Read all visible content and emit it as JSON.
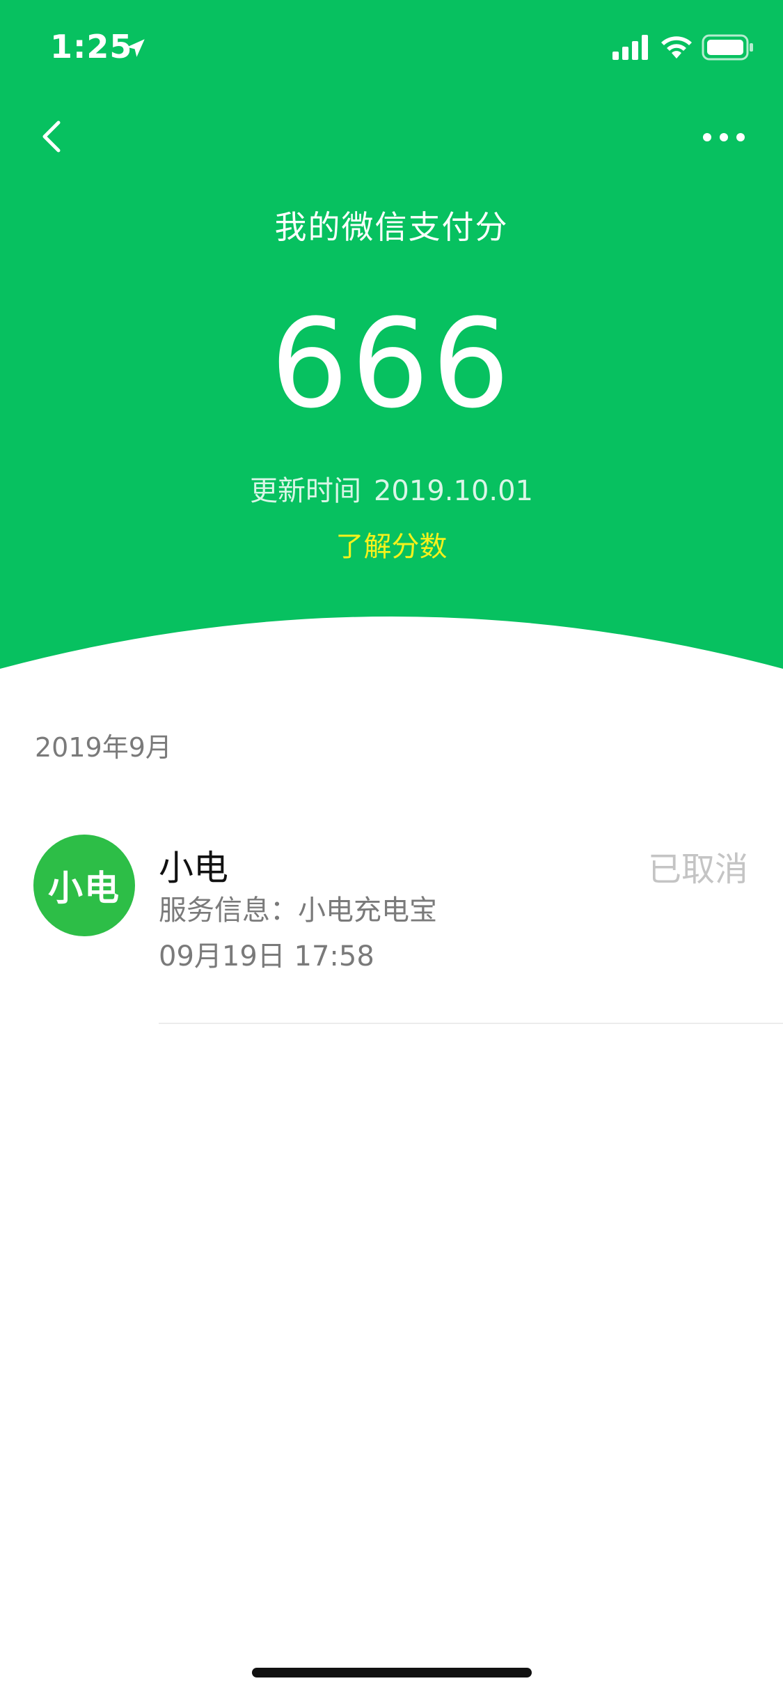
{
  "status_bar": {
    "time": "1:25",
    "location_icon": "location-arrow-icon",
    "signal_icon": "cellular-signal-icon",
    "wifi_icon": "wifi-icon",
    "battery_icon": "battery-icon"
  },
  "nav": {
    "back_icon": "chevron-left-icon",
    "more_icon": "more-dots-icon"
  },
  "header": {
    "title": "我的微信支付分",
    "score": "666",
    "update_label": "更新时间",
    "update_date": "2019.10.01",
    "learn_link": "了解分数"
  },
  "records": {
    "month": "2019年9月",
    "items": [
      {
        "avatar_text": "小电",
        "name": "小电",
        "status": "已取消",
        "service_info": "服务信息：小电充电宝",
        "time": "09月19日 17:58"
      }
    ]
  },
  "colors": {
    "brand_green": "#07C160",
    "avatar_green": "#2DBE47",
    "link_yellow": "#F5F21C",
    "muted_text": "#7a7a7a",
    "status_grey": "#c4c4c4"
  }
}
